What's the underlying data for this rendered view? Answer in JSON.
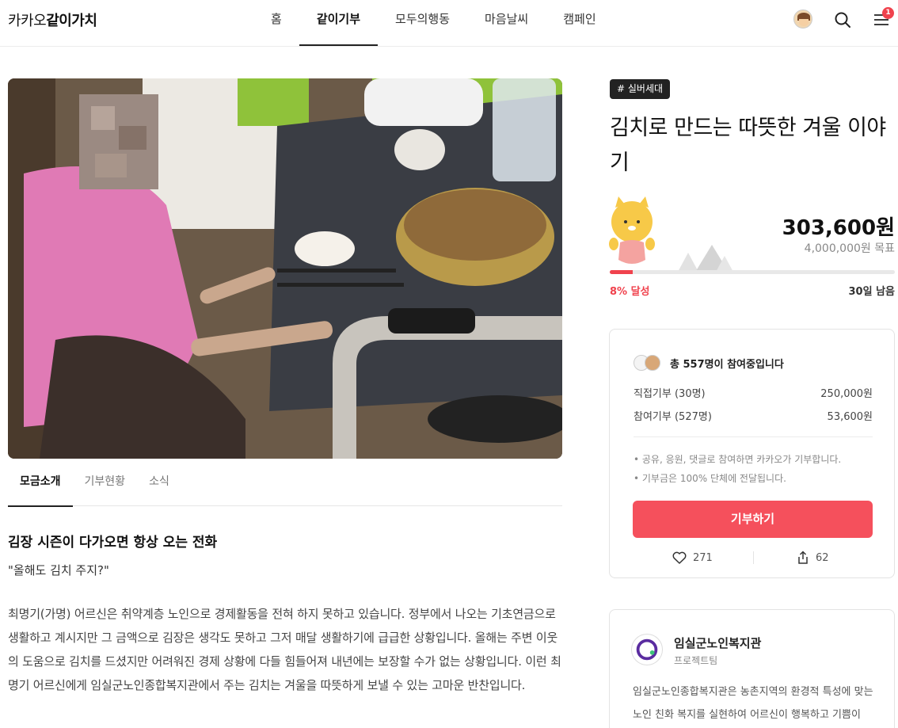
{
  "header": {
    "logo_prefix": "카카오",
    "logo_bold": "같이가치",
    "nav": [
      "홈",
      "같이기부",
      "모두의행동",
      "마음날씨",
      "캠페인"
    ],
    "active_nav": 1,
    "notification_count": "1"
  },
  "tabs": [
    "모금소개",
    "기부현황",
    "소식"
  ],
  "story": {
    "heading": "김장 시즌이 다가오면 항상 오는 전화",
    "quote": "\"올해도 김치 주지?\"",
    "body": "최명기(가명) 어르신은 취약계층 노인으로 경제활동을 전혀 하지 못하고 있습니다. 정부에서 나오는 기초연금으로 생활하고 계시지만 그 금액으로 김장은 생각도 못하고 그저 매달 생활하기에 급급한 상황입니다. 올해는 주변 이웃의 도움으로 김치를 드셨지만 어려워진 경제 상황에 다들 힘들어져 내년에는 보장할 수가 없는 상황입니다. 이런 최명기 어르신에게 임실군노인종합복지관에서 주는 김치는 겨울을 따뜻하게 보낼 수 있는 고마운 반찬입니다."
  },
  "campaign": {
    "tag": "# 실버세대",
    "title": "김치로 만드는 따뜻한 겨울 이야기",
    "amount": "303,600원",
    "goal": "4,000,000원 목표",
    "progress_percent": 8,
    "percent_label": "8% 달성",
    "days_left": "30일 남음"
  },
  "donation_card": {
    "participants": "총 557명이 참여중입니다",
    "rows": [
      {
        "label": "직접기부 (30명)",
        "value": "250,000원"
      },
      {
        "label": "참여기부 (527명)",
        "value": "53,600원"
      }
    ],
    "notes": [
      "• 공유, 응원, 댓글로 참여하면 카카오가 기부합니다.",
      "• 기부금은 100% 단체에 전달됩니다."
    ],
    "button": "기부하기",
    "likes": "271",
    "shares": "62"
  },
  "org": {
    "name": "임실군노인복지관",
    "sub": "프로젝트팀",
    "desc": "임실군노인종합복지관은 농촌지역의 환경적 특성에 맞는 노인 친화 복지를 실현하여 어르신이 행복하고 기쁨이"
  },
  "colors": {
    "accent": "#f5505c",
    "progress": "#f0424d",
    "text": "#222222"
  }
}
